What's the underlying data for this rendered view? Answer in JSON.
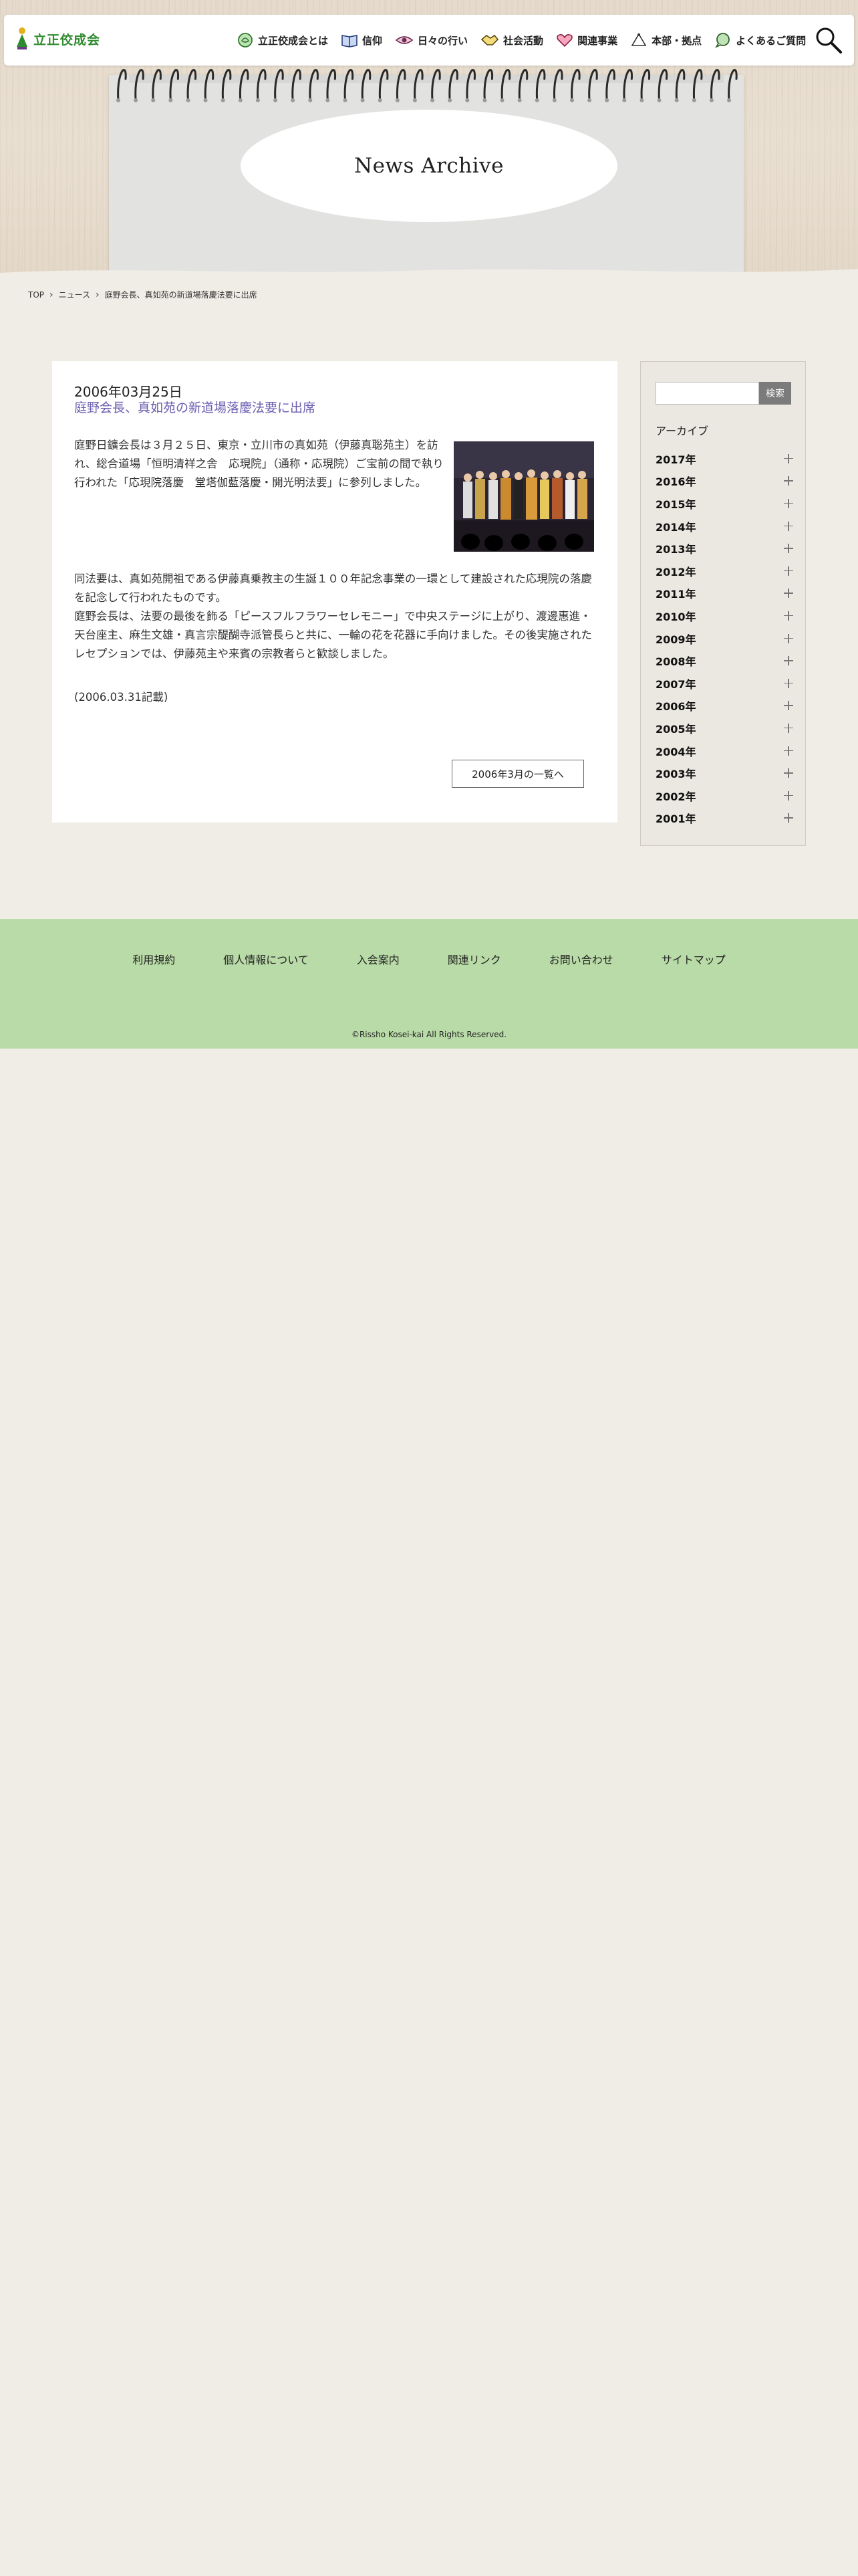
{
  "header": {
    "logo_text": "立正佼成会",
    "nav": [
      {
        "label": "立正佼成会とは",
        "icon": "lotus-circle-icon"
      },
      {
        "label": "信仰",
        "icon": "open-book-icon"
      },
      {
        "label": "日々の行い",
        "icon": "eye-icon"
      },
      {
        "label": "社会活動",
        "icon": "handshake-icon"
      },
      {
        "label": "関連事業",
        "icon": "heart-icon"
      },
      {
        "label": "本部・拠点",
        "icon": "building-icon"
      },
      {
        "label": "よくあるご質問",
        "icon": "speech-bubble-icon"
      }
    ],
    "search_icon": "magnifier-icon"
  },
  "hero": {
    "title": "News Archive"
  },
  "breadcrumb": [
    "TOP",
    "ニュース",
    "庭野会長、真如苑の新道場落慶法要に出席"
  ],
  "article": {
    "date": "2006年03月25日",
    "title": "庭野会長、真如苑の新道場落慶法要に出席",
    "paragraph1": "庭野日鑛会長は３月２５日、東京・立川市の真如苑（伊藤真聡苑主）を訪れ、総合道場「恒明清祥之舎　応現院」（通称・応現院）ご宝前の間で執り行われた「応現院落慶　堂塔伽藍落慶・開光明法要」に参列しました。",
    "paragraph2_lines": [
      "同法要は、真如苑開祖である伊藤真乗教主の生誕１００年記念事業の一環として建設された応現院の落慶を記念して行われたものです。",
      "庭野会長は、法要の最後を飾る「ピースフルフラワーセレモニー」で中央ステージに上がり、渡邊惠進・天台座主、麻生文雄・真言宗醍醐寺派管長らと共に、一輪の花を花器に手向けました。その後実施されたレセプションでは、伊藤苑主や来賓の宗教者らと歓談しました。"
    ],
    "note": "(2006.03.31記載)",
    "back_button": "2006年3月の一覧へ"
  },
  "sidebar": {
    "search_placeholder": "",
    "search_button": "検索",
    "archive_heading": "アーカイブ",
    "years": [
      "2017年",
      "2016年",
      "2015年",
      "2014年",
      "2013年",
      "2012年",
      "2011年",
      "2010年",
      "2009年",
      "2008年",
      "2007年",
      "2006年",
      "2005年",
      "2004年",
      "2003年",
      "2002年",
      "2001年"
    ]
  },
  "footer": {
    "links": [
      "利用規約",
      "個人情報について",
      "入会案内",
      "関連リンク",
      "お問い合わせ",
      "サイトマップ"
    ],
    "copyright": "©Rissho Kosei-kai All Rights Reserved."
  },
  "colors": {
    "background": "#f0ede6",
    "footer": "#b9dba7",
    "article_title": "#6b5fb0",
    "logo": "#2e8b2e"
  }
}
